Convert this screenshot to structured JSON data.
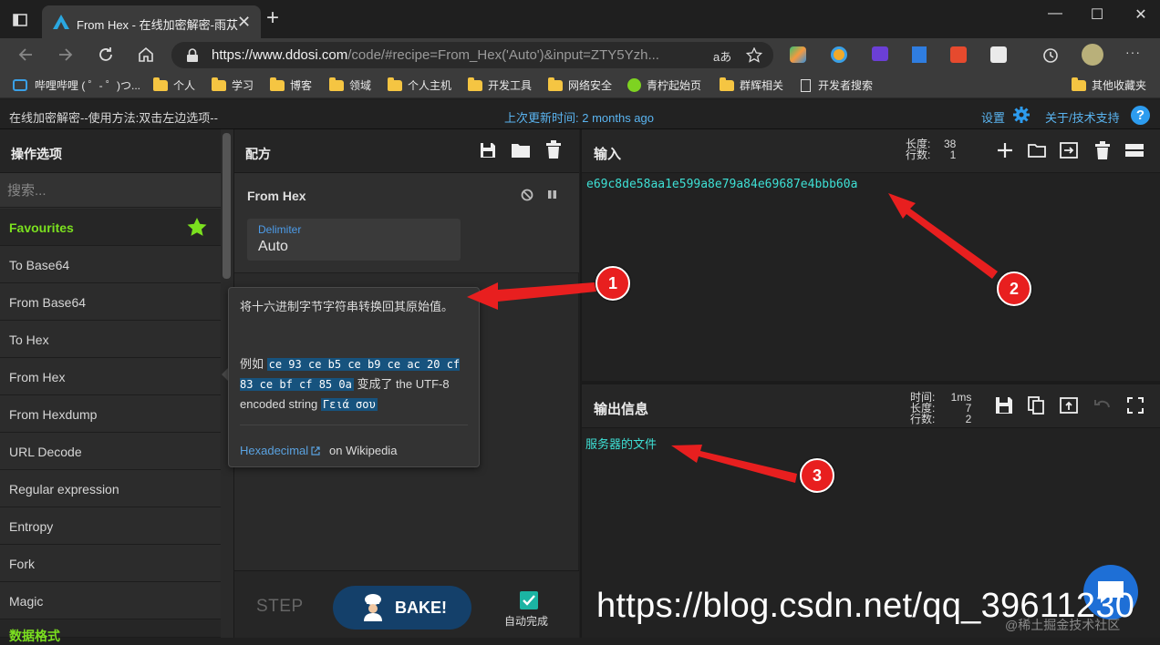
{
  "browser": {
    "tab_title": "From Hex - 在线加密解密-雨苁",
    "tab_close": "✕",
    "new_tab": "+",
    "url_host_prefix": "https://www.ddosi.com",
    "url_rest": "/code/#recipe=From_Hex('Auto')&input=ZTY5Yzh...",
    "reader_mode": "aあ",
    "window_min": "—",
    "window_max": "☐",
    "window_close": "✕",
    "menu_dots": "···"
  },
  "bookmarks": [
    {
      "label": "哔哩哔哩 ( ゜- ゜)つ...",
      "icon": "bilibili-icon"
    },
    {
      "label": "个人",
      "icon": "folder-icon"
    },
    {
      "label": "学习",
      "icon": "folder-icon"
    },
    {
      "label": "博客",
      "icon": "folder-icon"
    },
    {
      "label": "领域",
      "icon": "folder-icon"
    },
    {
      "label": "个人主机",
      "icon": "folder-icon"
    },
    {
      "label": "开发工具",
      "icon": "folder-icon"
    },
    {
      "label": "网络安全",
      "icon": "folder-icon"
    },
    {
      "label": "青柠起始页",
      "icon": "lime-icon"
    },
    {
      "label": "群辉相关",
      "icon": "folder-icon"
    },
    {
      "label": "开发者搜索",
      "icon": "page-icon"
    },
    {
      "label": "其他收藏夹",
      "icon": "folder-icon"
    }
  ],
  "app": {
    "hint": "在线加密解密--使用方法:双击左边选项--",
    "updated": "上次更新时间: 2 months ago",
    "settings": "设置",
    "about": "关于/技术支持"
  },
  "operations": {
    "title": "操作选项",
    "search_placeholder": "搜索...",
    "favourites": "Favourites",
    "items": [
      "To Base64",
      "From Base64",
      "To Hex",
      "From Hex",
      "From Hexdump",
      "URL Decode",
      "Regular expression",
      "Entropy",
      "Fork",
      "Magic"
    ],
    "next_category": "数据格式"
  },
  "recipe": {
    "title": "配方",
    "operation_name": "From Hex",
    "delimiter_label": "Delimiter",
    "delimiter_value": "Auto",
    "step_label": "STEP",
    "bake_label": "BAKE!",
    "autobake_label": "自动完成"
  },
  "popover": {
    "description": "将十六进制字节字符串转换回其原始值。",
    "example_prefix": "例如 ",
    "example_hex": "ce 93 ce b5 ce b9 ce ac 20 cf 83 ce bf cf 85 0a",
    "example_mid": " 变成了 the UTF-8 encoded string ",
    "example_result": "Γειά σου",
    "link_label": "Hexadecimal",
    "link_suffix": "on Wikipedia"
  },
  "input": {
    "title": "输入",
    "length_label": "长度:",
    "length_value": "38",
    "lines_label": "行数:",
    "lines_value": "1",
    "text": "e69c8de58aa1e599a8e79a84e69687e4bbb60a"
  },
  "output": {
    "title": "输出信息",
    "time_label": "时间:",
    "time_value": "1ms",
    "length_label": "长度:",
    "length_value": "7",
    "lines_label": "行数:",
    "lines_value": "2",
    "text": "服务器的文件"
  },
  "annotations": {
    "badge1": "1",
    "badge2": "2",
    "badge3": "3",
    "watermark": "https://blog.csdn.net/qq_39611230",
    "watermark2": "@稀土掘金技术社区"
  },
  "colors": {
    "accent": "#5ab4f0",
    "favourite": "#7be01f",
    "io_text": "#3ee0d5",
    "bake": "#14406a",
    "annotation_red": "#e81f1f"
  }
}
